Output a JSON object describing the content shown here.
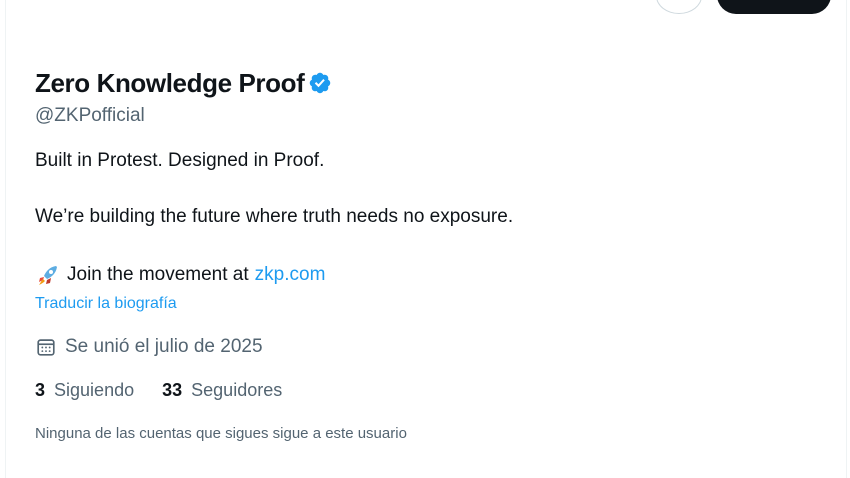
{
  "profile": {
    "display_name": "Zero Knowledge Proof",
    "handle": "@ZKPofficial",
    "verified_icon": "verified-badge-icon",
    "bio": {
      "line1": "Built in Protest. Designed in Proof.",
      "line2": "We’re building the future where truth needs no exposure.",
      "line3_text": "Join the movement at",
      "line3_link": "zkp.com",
      "emoji_icon": "rocket-icon"
    },
    "translate_label": "Traducir la biografía",
    "joined": "Se unió el julio de 2025",
    "following": {
      "count": "3",
      "label": "Siguiendo"
    },
    "followers": {
      "count": "33",
      "label": "Seguidores"
    },
    "followers_note": "Ninguna de las cuentas que sigues sigue a este usuario"
  },
  "colors": {
    "accent": "#1d9bf0",
    "text_primary": "#0f1419",
    "text_secondary": "#536471",
    "follow_button_bg": "#0f1419"
  }
}
